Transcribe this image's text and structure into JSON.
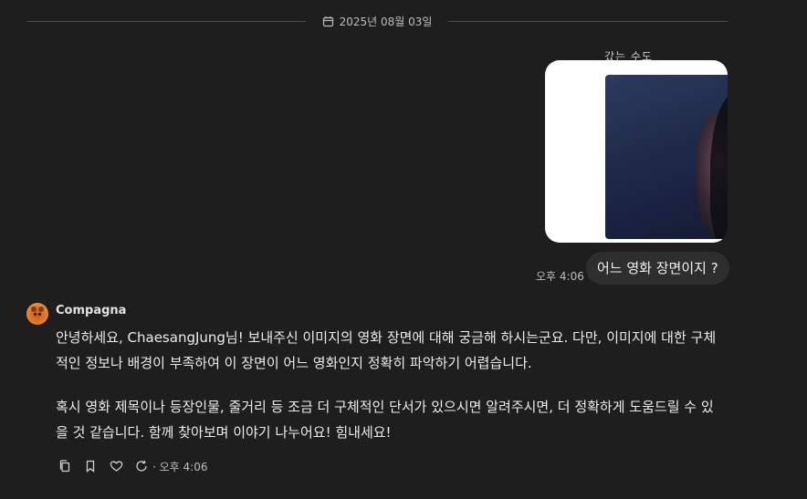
{
  "date_divider": {
    "date": "2025년 08월 03일",
    "icon": "calendar-icon"
  },
  "user_message": {
    "attachment_overflow_text": "갔는 수도",
    "attachment_alt": "영화 장면 이미지",
    "text": "어느 영화 장면이지 ?",
    "time": "오후 4:06"
  },
  "assistant_message": {
    "name": "Compagna",
    "paragraphs": [
      "안녕하세요, ChaesangJung님! 보내주신 이미지의 영화 장면에 대해 궁금해 하시는군요. 다만, 이미지에 대한 구체적인 정보나 배경이 부족하여 이 장면이 어느 영화인지 정확히 파악하기 어렵습니다.",
      "혹시 영화 제목이나 등장인물, 줄거리 등 조금 더 구체적인 단서가 있으시면 알려주시면, 더 정확하게 도움드릴 수 있을 것 같습니다. 함께 찾아보며 이야기 나누어요! 힘내세요!"
    ],
    "time": "· 오후 4:06",
    "actions": [
      "copy-icon",
      "bookmark-icon",
      "heart-icon",
      "refresh-icon"
    ]
  },
  "colors": {
    "background": "#1e1e1e",
    "bubble": "#2e2e2e",
    "text": "#ececec",
    "muted": "#bdbdbd"
  }
}
